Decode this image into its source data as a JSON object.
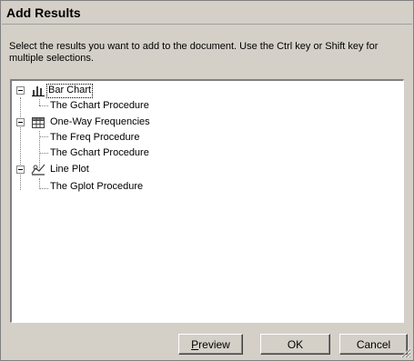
{
  "window": {
    "title": "Add Results"
  },
  "instructions": "Select the results you want to add to the document.  Use the Ctrl key or Shift key for multiple selections.",
  "tree": {
    "nodes": [
      {
        "label": "Bar Chart",
        "icon": "bar-chart-icon",
        "expanded": true,
        "selected": true,
        "children": [
          {
            "label": "The Gchart Procedure"
          }
        ]
      },
      {
        "label": "One-Way Frequencies",
        "icon": "table-icon",
        "expanded": true,
        "selected": false,
        "children": [
          {
            "label": "The Freq Procedure"
          },
          {
            "label": "The Gchart Procedure"
          }
        ]
      },
      {
        "label": "Line Plot",
        "icon": "line-plot-icon",
        "expanded": true,
        "selected": false,
        "children": [
          {
            "label": "The Gplot Procedure"
          }
        ]
      }
    ]
  },
  "buttons": {
    "preview_first": "P",
    "preview_rest": "review",
    "ok": "OK",
    "cancel": "Cancel"
  },
  "colors": {
    "dialog_bg": "#d4d0c8",
    "tree_bg": "#ffffff",
    "text": "#000000"
  }
}
